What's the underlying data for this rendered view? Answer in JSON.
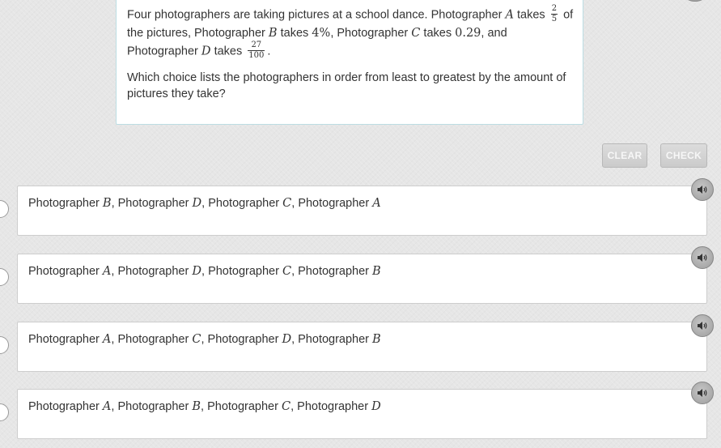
{
  "question": {
    "text_before_a": "Four photographers are taking pictures at a school dance. Photographer ",
    "var_a": "A",
    "takes_1": " takes ",
    "frac_a_num": "2",
    "frac_a_den": "5",
    "of_break": " of the pictures, Photographer ",
    "var_b": "B",
    "takes_2": " takes ",
    "val_b": "4%",
    "after_b": ", Photographer ",
    "var_c": "C",
    "takes_3": " takes ",
    "val_c": "0.29",
    "after_c": ", and Photographer ",
    "var_d": "D",
    "takes_4": " takes ",
    "frac_d_num": "27",
    "frac_d_den": "100",
    "period": ".",
    "prompt": "Which choice lists the photographers in order from least to greatest by the amount of pictures they take?"
  },
  "buttons": {
    "clear": "CLEAR",
    "check": "CHECK"
  },
  "choice_prefix": "Photographer ",
  "separator": ", ",
  "choices": [
    {
      "order": [
        "B",
        "D",
        "C",
        "A"
      ]
    },
    {
      "order": [
        "A",
        "D",
        "C",
        "B"
      ]
    },
    {
      "order": [
        "A",
        "C",
        "D",
        "B"
      ]
    },
    {
      "order": [
        "A",
        "B",
        "C",
        "D"
      ]
    }
  ],
  "icons": {
    "audio": "speaker-icon",
    "radio": "radio-circle"
  }
}
